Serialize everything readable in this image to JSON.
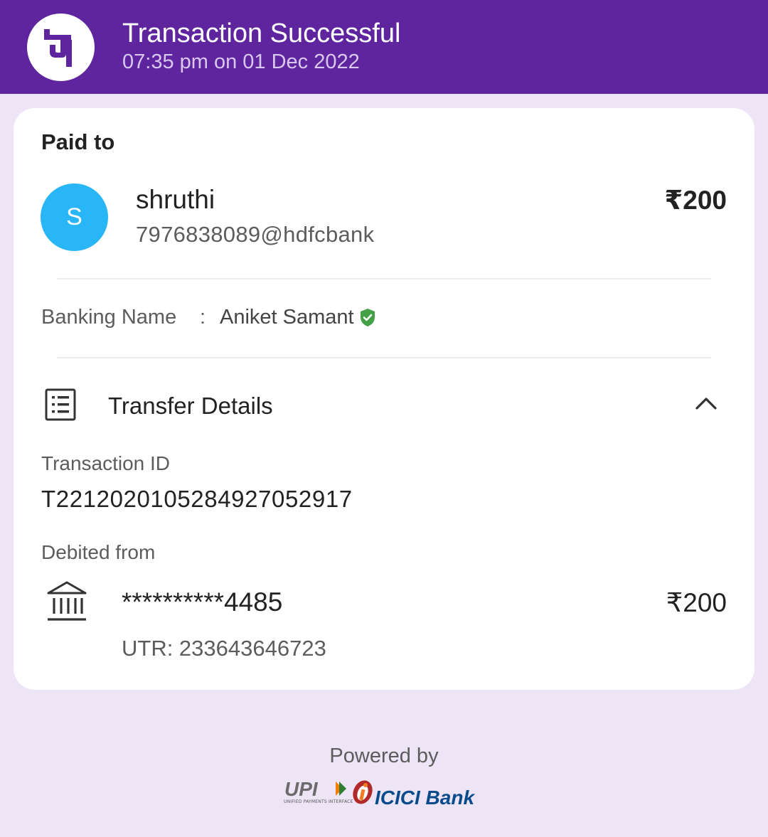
{
  "header": {
    "title": "Transaction Successful",
    "subtitle": "07:35 pm on 01 Dec 2022",
    "logo_icon": "phonepe-logo-icon",
    "brand_color": "#5f259f"
  },
  "payee": {
    "section_label": "Paid to",
    "avatar_initial": "S",
    "avatar_color": "#29b6f6",
    "name": "shruthi",
    "vpa": "7976838089@hdfcbank",
    "amount": "₹200"
  },
  "banking": {
    "label": "Banking Name",
    "separator": ":",
    "value": "Aniket Samant",
    "verified_icon": "verified-shield-icon",
    "verified_color": "#43a047"
  },
  "transfer": {
    "title": "Transfer Details",
    "icon": "receipt-list-icon",
    "toggle_icon": "chevron-up-icon",
    "transaction_id_label": "Transaction ID",
    "transaction_id": "T2212020105284927052917",
    "debited_label": "Debited from",
    "bank_icon": "bank-building-icon",
    "account_masked": "**********4485",
    "debited_amount": "₹200",
    "utr": "UTR: 233643646723"
  },
  "footer": {
    "powered_by": "Powered by",
    "upi_logo_text": "UPI",
    "upi_subtext": "UNIFIED PAYMENTS INTERFACE",
    "bank_name": "ICICI Bank"
  }
}
